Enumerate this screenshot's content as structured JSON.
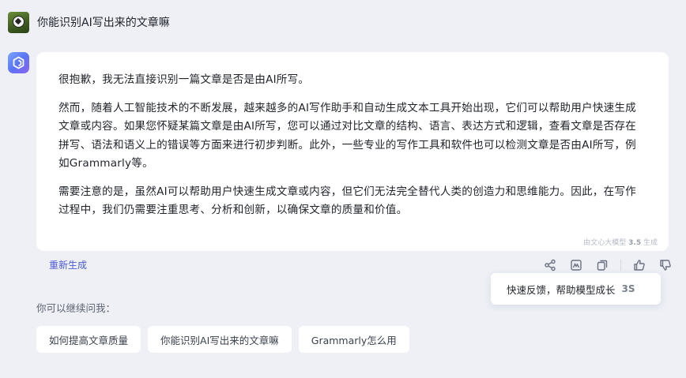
{
  "user": {
    "avatar_icon": "soccer-ball-icon",
    "question": "你能识别AI写出来的文章嘛"
  },
  "bot": {
    "avatar_icon": "ernie-bot-logo-icon",
    "paragraphs": [
      "很抱歉，我无法直接识别一篇文章是否是由AI所写。",
      "然而，随着人工智能技术的不断发展，越来越多的AI写作助手和自动生成文本工具开始出现，它们可以帮助用户快速生成文章或内容。如果您怀疑某篇文章是由AI所写，您可以通过对比文章的结构、语言、表达方式和逻辑，查看文章是否存在拼写、语法和语义上的错误等方面来进行初步判断。此外，一些专业的写作工具和软件也可以检测文章是否由AI所写，例如Grammarly等。",
      "需要注意的是，虽然AI可以帮助用户快速生成文章或内容，但它们无法完全替代人类的创造力和思维能力。因此，在写作过程中，我们仍需要注重思考、分析和创新，以确保文章的质量和价值。"
    ],
    "model_note_prefix": "由文心大模型",
    "model_note_version": "3.5",
    "model_note_suffix": "生成"
  },
  "actions": {
    "regenerate_label": "重新生成",
    "icons": [
      "share-icon",
      "image-icon",
      "copy-icon",
      "thumbs-up-icon",
      "thumbs-down-icon"
    ]
  },
  "tooltip": {
    "text": "快速反馈，帮助模型成长",
    "count": "3S"
  },
  "suggestions": {
    "label": "你可以继续问我：",
    "items": [
      "如何提高文章质量",
      "你能识别AI写出来的文章嘛",
      "Grammarly怎么用"
    ]
  },
  "colors": {
    "background": "#eef0f6",
    "card": "#ffffff",
    "link": "#4c5ad4"
  }
}
